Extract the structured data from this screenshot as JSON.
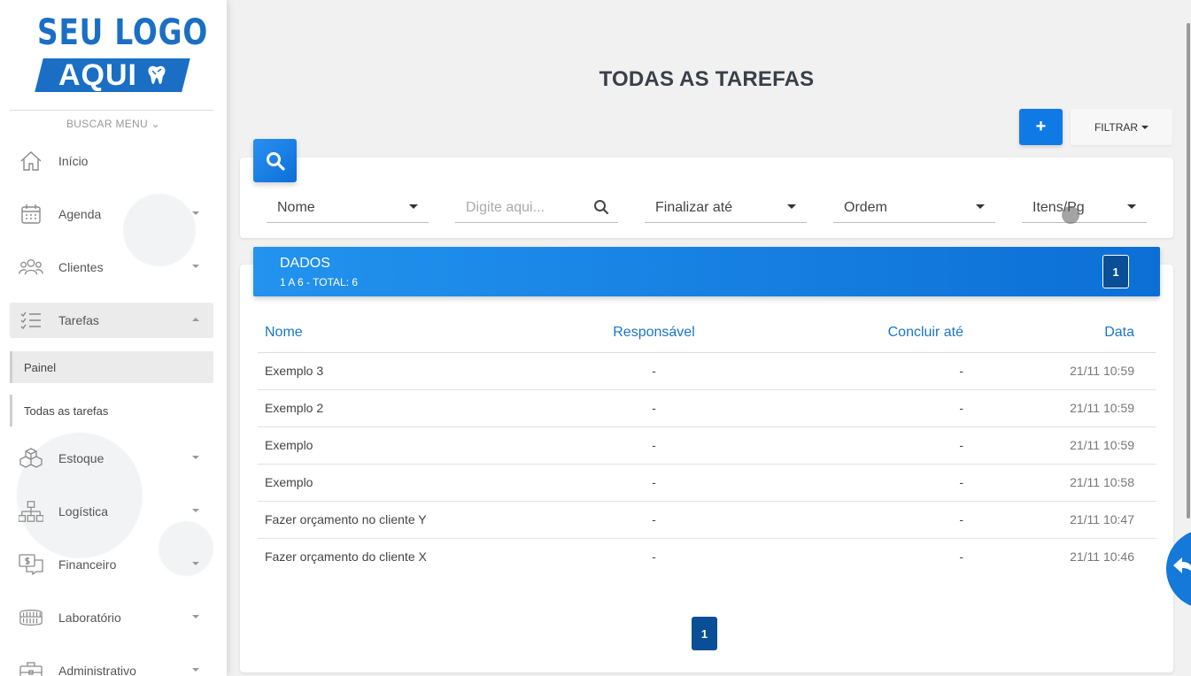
{
  "logo": {
    "line1": "SEU LOGO",
    "line2": "AQUI"
  },
  "sidebar": {
    "search_menu": "BUSCAR MENU",
    "items": [
      {
        "label": "Início",
        "icon": "home-icon"
      },
      {
        "label": "Agenda",
        "icon": "calendar-icon"
      },
      {
        "label": "Clientes",
        "icon": "users-icon"
      },
      {
        "label": "Tarefas",
        "icon": "checklist-icon"
      },
      {
        "label": "Estoque",
        "icon": "boxes-icon"
      },
      {
        "label": "Logística",
        "icon": "hierarchy-icon"
      },
      {
        "label": "Financeiro",
        "icon": "money-chat-icon"
      },
      {
        "label": "Laboratório",
        "icon": "dental-arch-icon"
      },
      {
        "label": "Administrativo",
        "icon": "briefcase-icon"
      }
    ],
    "sub_items": [
      {
        "label": "Painel"
      },
      {
        "label": "Todas as tarefas"
      }
    ]
  },
  "page": {
    "title": "TODAS AS TAREFAS"
  },
  "toolbar": {
    "add_label": "+",
    "filter_label": "FILTRAR"
  },
  "filters": {
    "field_select": "Nome",
    "search_placeholder": "Digite aqui...",
    "finish_select": "Finalizar até",
    "order_select": "Ordem",
    "per_page_select": "Itens/Pg"
  },
  "data_panel": {
    "title": "DADOS",
    "subtitle": "1 A 6 - TOTAL: 6",
    "page_badge": "1"
  },
  "table": {
    "columns": [
      "Nome",
      "Responsável",
      "Concluir até",
      "Data"
    ],
    "rows": [
      {
        "name": "Exemplo 3",
        "resp": "-",
        "until": "-",
        "date": "21/11 10:59"
      },
      {
        "name": "Exemplo 2",
        "resp": "-",
        "until": "-",
        "date": "21/11 10:59"
      },
      {
        "name": "Exemplo",
        "resp": "-",
        "until": "-",
        "date": "21/11 10:59"
      },
      {
        "name": "Exemplo",
        "resp": "-",
        "until": "-",
        "date": "21/11 10:58"
      },
      {
        "name": "Fazer orçamento no cliente Y",
        "resp": "-",
        "until": "-",
        "date": "21/11 10:47"
      },
      {
        "name": "Fazer orçamento do cliente X",
        "resp": "-",
        "until": "-",
        "date": "21/11 10:46"
      }
    ]
  },
  "pagination": {
    "current": "1"
  },
  "colors": {
    "accent": "#0f7ae5",
    "dark_accent": "#0a4e96",
    "header_text": "#1a76c8"
  }
}
